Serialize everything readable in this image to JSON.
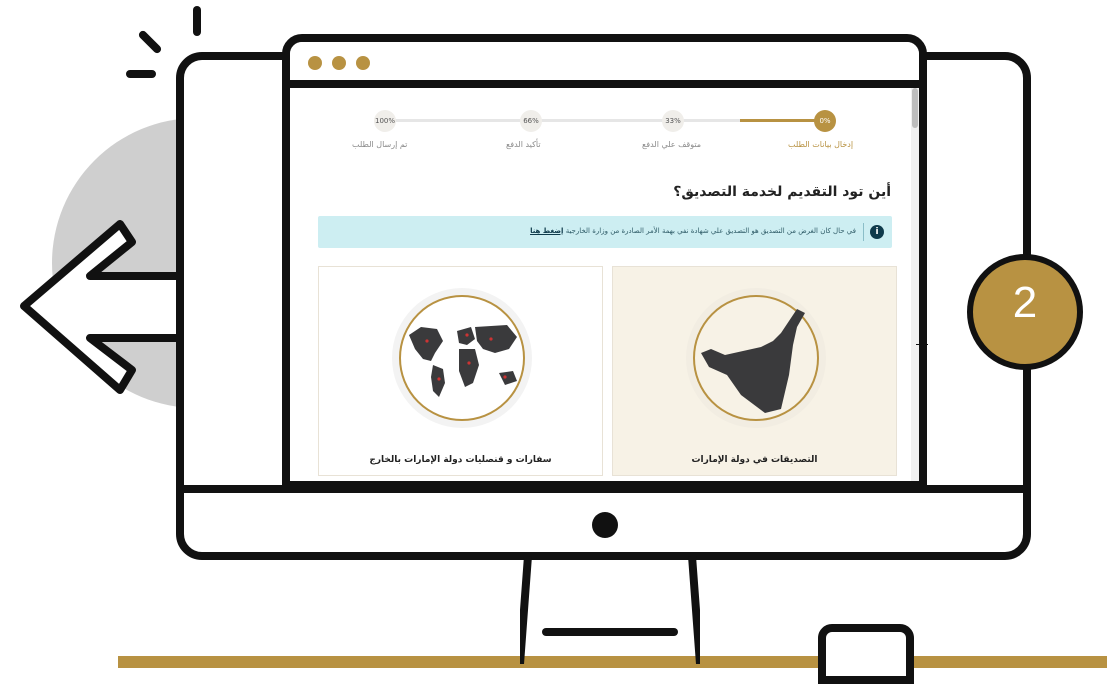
{
  "browser": {
    "dots": 3,
    "dot_color": "#b89242"
  },
  "progress": {
    "steps": [
      {
        "percent": "0%",
        "label": "إدخال بيانات الطلب",
        "active": true
      },
      {
        "percent": "33%",
        "label": "متوقف علي الدفع",
        "active": false
      },
      {
        "percent": "66%",
        "label": "تأكيد الدفع",
        "active": false
      },
      {
        "percent": "100%",
        "label": "تم إرسال الطلب",
        "active": false
      }
    ],
    "accent": "#b89242"
  },
  "page": {
    "heading": "أين تود التقديم لخدمة التصديق؟",
    "alert": {
      "icon": "info-icon",
      "text": "في حال كان الغرض من التصديق هو التصديق علي شهادة نفي بهمة الأمر الصادرة من وزارة الخارجية",
      "link": "إضغط هنا"
    },
    "cards": [
      {
        "label": "التصديقات في دولة الإمارات",
        "icon": "uae-map-icon"
      },
      {
        "label": "سفارات و قنصليات دولة الإمارات بالخارج",
        "icon": "world-map-icon"
      }
    ]
  },
  "step_badge": {
    "number": "2",
    "color": "#b89242"
  },
  "colors": {
    "brand": "#b89242",
    "alert_bg": "#cdeef2",
    "ink": "#111111"
  }
}
